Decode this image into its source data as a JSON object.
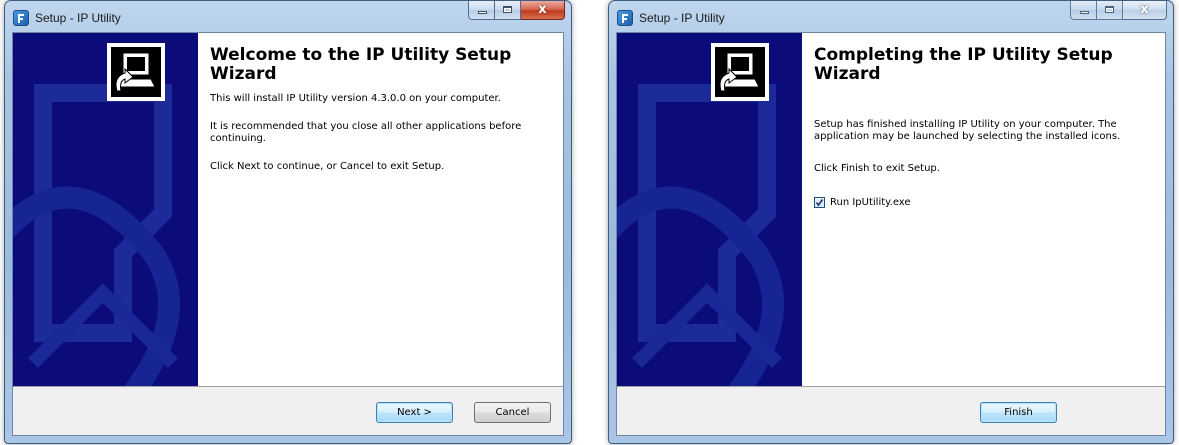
{
  "windows": [
    {
      "title": "Setup - IP Utility",
      "close_glyph": "x",
      "heading": "Welcome to the IP Utility Setup Wizard",
      "paragraphs": [
        "This will install IP Utility version 4.3.0.0 on your computer.",
        "It is recommended that you close all other applications before continuing.",
        "Click Next to continue, or Cancel to exit Setup."
      ],
      "buttons": {
        "next": "Next >",
        "cancel": "Cancel"
      }
    },
    {
      "title": "Setup - IP Utility",
      "close_glyph": "x",
      "heading": "Completing the IP Utility Setup Wizard",
      "paragraphs": [
        "Setup has finished installing IP Utility on your computer. The application may be launched by selecting the installed icons.",
        "Click Finish to exit Setup."
      ],
      "checkbox": {
        "label": "Run IpUtility.exe",
        "checked": true
      },
      "buttons": {
        "finish": "Finish"
      }
    }
  ],
  "icons": {
    "app": "setup-app-icon",
    "wizard": "computer-install-icon",
    "check": "checkmark-icon"
  },
  "colors": {
    "sidebar": "#0b0b7a",
    "titlebar": "#a8c4e3",
    "close_button": "#c0391f",
    "default_button_border": "#3c7fb1"
  }
}
